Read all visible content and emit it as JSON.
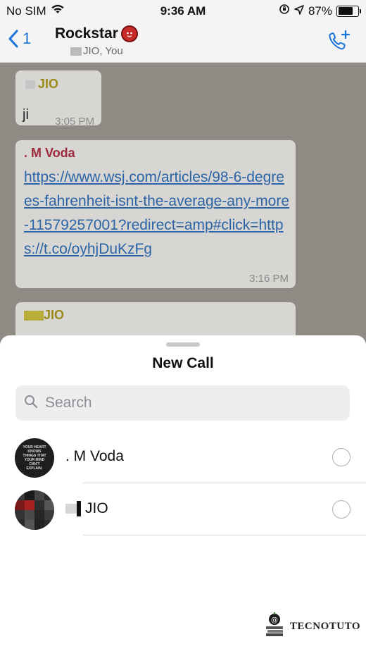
{
  "status_bar": {
    "carrier": "No SIM",
    "time": "9:36 AM",
    "battery": "87%",
    "battery_level": 0.87
  },
  "nav": {
    "back_count": "1",
    "chat_title": "Rockstar",
    "subtitle": "JIO, You"
  },
  "messages": [
    {
      "sender": "JIO",
      "text": "ji",
      "time": "3:05 PM",
      "sender_color": "#9a8a1a"
    },
    {
      "sender": ". M Voda",
      "text": "https://www.wsj.com/articles/98-6-degrees-fahrenheit-isnt-the-average-any-more-11579257001?redirect=amp#click=https://t.co/oyhjDuKzFg",
      "time": "3:16 PM",
      "sender_color": "#9c2a3a"
    },
    {
      "sender": "JIO",
      "sender_color": "#9a8a1a"
    }
  ],
  "sheet": {
    "title": "New Call",
    "search_placeholder": "Search",
    "contacts": [
      {
        "name": ". M Voda",
        "avatar_text": "YOUR HEART KNOWS THINGS THAT YOUR MIND CAN'T EXPLAIN.",
        "selected": false
      },
      {
        "name": "JIO",
        "selected": false
      }
    ]
  },
  "watermark": {
    "text": "TECNOTUTO"
  },
  "colors": {
    "accent": "#1a73d9",
    "chat_background": "#8f8a84"
  },
  "icons": [
    "wifi-icon",
    "lock-rotation-icon",
    "location-arrow-icon",
    "battery-icon",
    "back-chevron-icon",
    "devil-emoji-icon",
    "add-call-icon",
    "search-icon",
    "radio-unselected-icon",
    "tecnotuto-logo-icon"
  ]
}
